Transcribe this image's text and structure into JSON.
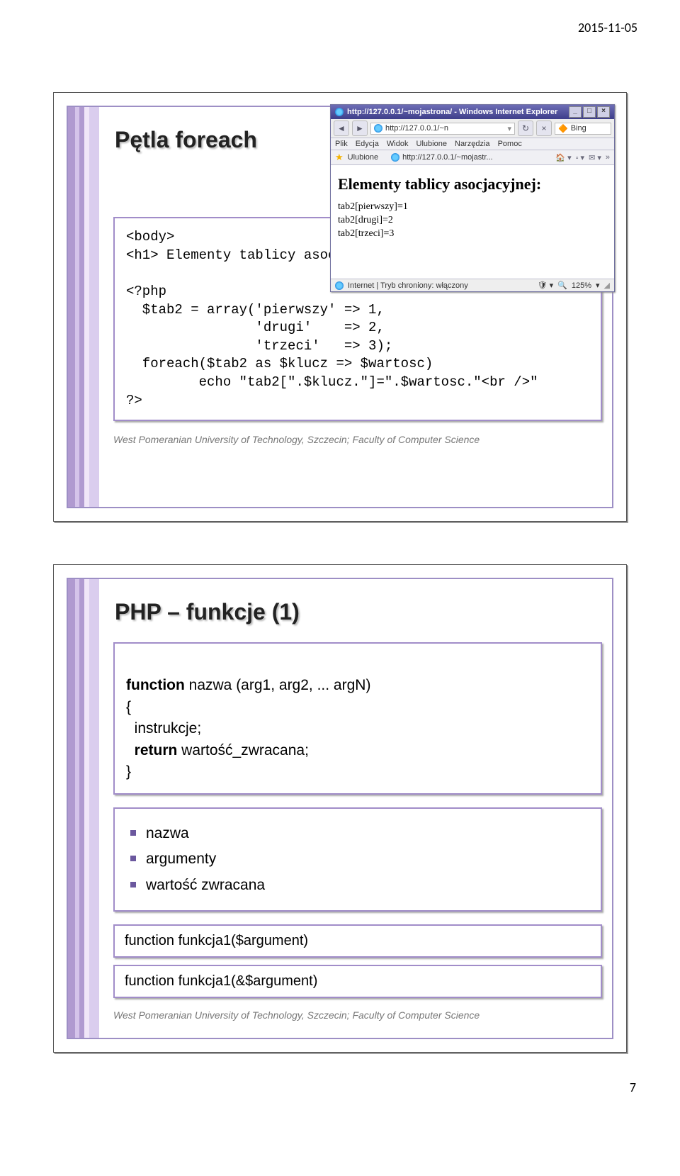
{
  "date": "2015-11-05",
  "pagenum": "7",
  "footer": "West Pomeranian University of Technology, Szczecin; Faculty of Computer Science",
  "slide1": {
    "title": "Pętla foreach",
    "code": "<body>\n<h1> Elementy tablicy asocjacyjnej: </h1>\n\n<?php\n  $tab2 = array('pierwszy' => 1,\n                'drugi'    => 2,\n                'trzeci'   => 3);\n  foreach($tab2 as $klucz => $wartosc)\n         echo \"tab2[\".$klucz.\"]=\".$wartosc.\"<br />\"\n?>"
  },
  "browser": {
    "winTitle": "http://127.0.0.1/~mojastrona/ - Windows Internet Explorer",
    "addr": "http://127.0.0.1/~n",
    "bing": "Bing",
    "menus": [
      "Plik",
      "Edycja",
      "Widok",
      "Ulubione",
      "Narzędzia",
      "Pomoc"
    ],
    "favLabel": "Ulubione",
    "tab": "http://127.0.0.1/~mojastr...",
    "heading": "Elementy tablicy asocjacyjnej:",
    "lines": [
      "tab2[pierwszy]=1",
      "tab2[drugi]=2",
      "tab2[trzeci]=3"
    ],
    "status": "Internet | Tryb chroniony: włączony",
    "zoom": "125%"
  },
  "slide2": {
    "title": "PHP – funkcje (1)",
    "def_l1": "function nazwa (arg1, arg2, ... argN)",
    "def_l2": "{",
    "def_l3": "  instrukcje;",
    "def_l4_kw": "  return",
    "def_l4_rest": " wartość_zwracana;",
    "def_l5": "}",
    "bullet1": "nazwa",
    "bullet2": "argumenty",
    "bullet3": "wartość zwracana",
    "sig1": "function funkcja1($argument)",
    "sig2": "function funkcja1(&$argument)"
  }
}
